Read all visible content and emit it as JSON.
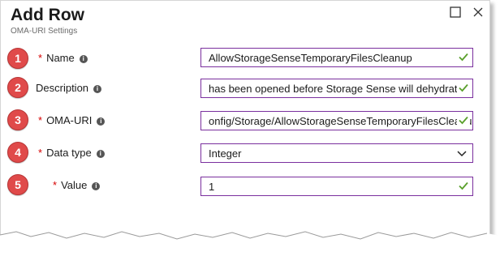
{
  "dialog": {
    "title": "Add Row",
    "subtitle": "OMA-URI Settings",
    "controls": [
      "maximize-icon",
      "close-icon"
    ]
  },
  "rows": [
    {
      "step": "1",
      "required": true,
      "label": "Name",
      "value": "AllowStorageSenseTemporaryFilesCleanup",
      "validated": true,
      "type": "text"
    },
    {
      "step": "2",
      "required": false,
      "label": "Description",
      "value": " has been opened before Storage Sense will dehydrate",
      "validated": true,
      "type": "text"
    },
    {
      "step": "3",
      "required": true,
      "label": "OMA-URI",
      "value": "onfig/Storage/AllowStorageSenseTemporaryFilesCleanu",
      "validated": true,
      "type": "text"
    },
    {
      "step": "4",
      "required": true,
      "label": "Data type",
      "value": "Integer",
      "validated": false,
      "type": "select"
    },
    {
      "step": "5",
      "required": true,
      "label": "Value",
      "value": "1",
      "validated": true,
      "type": "text"
    }
  ],
  "colors": {
    "accent": "#7a2f9e",
    "required": "#d60000",
    "badge": "#e04a4a",
    "check": "#5aa02c"
  }
}
